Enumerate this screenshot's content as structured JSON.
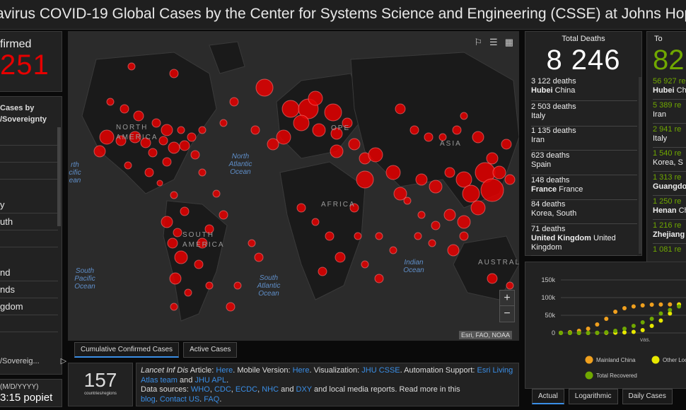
{
  "title": "avirus COVID-19 Global Cases by the Center for Systems Science and Engineering (CSSE) at Johns Hopkins Universit",
  "left": {
    "total_label": "firmed",
    "total_value": "251",
    "list_header": [
      "Cases by",
      "/Sovereignty"
    ],
    "items": [
      "",
      "",
      "",
      "y",
      "uth",
      "",
      "nd",
      "nds",
      "gdom",
      ""
    ],
    "footer_label": "/Sovereig...",
    "date_label": "(M/D/YYYY)",
    "date_value": "3:15 popiet"
  },
  "map": {
    "tools": [
      "bookmark-icon",
      "list-icon",
      "qr-grid-icon"
    ],
    "zoom_in": "+",
    "zoom_out": "−",
    "attribution": "Esri, FAO, NOAA",
    "oceans": {
      "n_atlantic": "North Atlantic Ocean",
      "n_pacific": "rth cific ean",
      "s_pacific": "South Pacific Ocean",
      "s_atlantic": "South Atlantic Ocean",
      "indian": "Indian Ocean"
    },
    "continents": {
      "na": "NORTH AMERICA",
      "sa": "SOUTH AMERICA",
      "africa": "AFRICA",
      "europe": "OPE",
      "asia": "ASIA",
      "australia": "AUSTRALI"
    },
    "tabs": [
      "Cumulative Confirmed Cases",
      "Active Cases"
    ]
  },
  "countries": {
    "count": "157",
    "label": "countries/regions"
  },
  "info": {
    "l1_a": "Lancet Inf Dis",
    "l1_b": " Article: ",
    "l1_here1": "Here",
    "l1_c": ". Mobile Version: ",
    "l1_here2": "Here",
    "l1_d": ". Visualization: ",
    "l1_jhu": "JHU CSSE",
    "l1_e": ". Automation Support: ",
    "l1_esri": "Esri Living Atlas team",
    "l1_f": " and ",
    "l1_apl": "JHU APL",
    "l1_g": ".",
    "l2_a": "Data sources: ",
    "l2_who": "WHO",
    "l2_cdc": "CDC",
    "l2_ecdc": "ECDC",
    "l2_nhc": "NHC",
    "l2_dxy": "DXY",
    "l2_b": " and local media reports. Read more in this",
    "l3_blog": "blog",
    "l3_contact": "Contact US",
    "l3_faq": "FAQ"
  },
  "deaths": {
    "header": "Total Deaths",
    "total": "8 246",
    "rows": [
      {
        "num": "3 122 deaths",
        "place_bold": "Hubei",
        "place": " China"
      },
      {
        "num": "2 503 deaths",
        "place_bold": "",
        "place": "Italy"
      },
      {
        "num": "1 135 deaths",
        "place_bold": "",
        "place": "Iran"
      },
      {
        "num": "623 deaths",
        "place_bold": "",
        "place": "Spain"
      },
      {
        "num": "148 deaths",
        "place_bold": "France",
        "place": " France"
      },
      {
        "num": "84 deaths",
        "place_bold": "",
        "place": "Korea, South"
      },
      {
        "num": "71 deaths",
        "place_bold": "United Kingdom",
        "place": " United Kingdom"
      }
    ]
  },
  "recovered": {
    "header": "To",
    "total": "82",
    "rows": [
      {
        "num": "56 927 re",
        "place_bold": "Hubei",
        "place": " Ch"
      },
      {
        "num": "5 389 re",
        "place_bold": "",
        "place": "Iran"
      },
      {
        "num": "2 941 re",
        "place_bold": "",
        "place": "Italy"
      },
      {
        "num": "1 540 re",
        "place_bold": "",
        "place": "Korea, S"
      },
      {
        "num": "1 313 re",
        "place_bold": "Guangdo",
        "place": ""
      },
      {
        "num": "1 250 re",
        "place_bold": "Henan",
        "place": " Ch"
      },
      {
        "num": "1 216 re",
        "place_bold": "Zhejiang",
        "place": ""
      },
      {
        "num": "1 081 re",
        "place_bold": "",
        "place": ""
      }
    ]
  },
  "chart_data": {
    "type": "line",
    "yticks": [
      "150k",
      "100k",
      "50k",
      "0"
    ],
    "ylim": [
      0,
      150000
    ],
    "x_label": "vas.",
    "series": [
      {
        "name": "Mainland China",
        "color": "#f0a01e",
        "values": [
          555,
          2000,
          6000,
          12000,
          24000,
          40000,
          60000,
          70000,
          75000,
          78000,
          80000,
          80500,
          80800,
          80900,
          81000
        ]
      },
      {
        "name": "Other Locations",
        "color": "#e8e800",
        "values": [
          0,
          0,
          50,
          100,
          200,
          400,
          800,
          1500,
          3000,
          8000,
          20000,
          35000,
          55000,
          80000,
          100000
        ]
      },
      {
        "name": "Total Recovered",
        "color": "#70a800",
        "values": [
          0,
          0,
          0,
          100,
          500,
          2000,
          6000,
          12000,
          20000,
          30000,
          40000,
          55000,
          65000,
          75000,
          82000
        ]
      }
    ],
    "tabs": [
      "Actual",
      "Logarithmic",
      "Daily Cases"
    ]
  }
}
